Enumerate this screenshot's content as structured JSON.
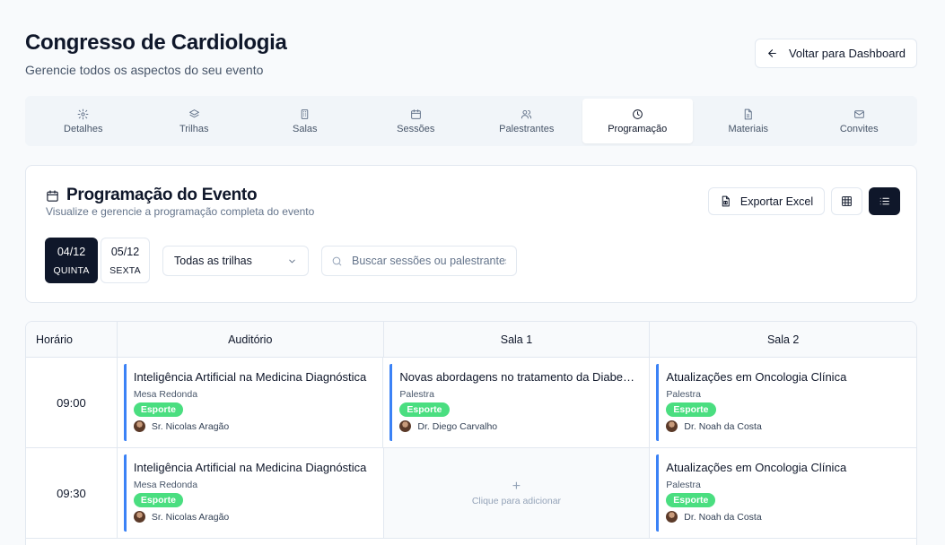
{
  "header": {
    "title": "Congresso de Cardiologia",
    "subtitle": "Gerencie todos os aspectos do seu evento",
    "back_label": "Voltar para Dashboard"
  },
  "tabs": [
    {
      "label": "Detalhes",
      "icon": "gear-icon"
    },
    {
      "label": "Trilhas",
      "icon": "layers-icon"
    },
    {
      "label": "Salas",
      "icon": "building-icon"
    },
    {
      "label": "Sessões",
      "icon": "calendar-icon"
    },
    {
      "label": "Palestrantes",
      "icon": "users-icon"
    },
    {
      "label": "Programação",
      "icon": "clock-icon",
      "active": true
    },
    {
      "label": "Materiais",
      "icon": "file-icon"
    },
    {
      "label": "Convites",
      "icon": "mail-icon"
    }
  ],
  "program": {
    "title": "Programação do Evento",
    "description": "Visualize e gerencie a programação completa do evento",
    "export_label": "Exportar Excel",
    "days": [
      {
        "date": "04/12",
        "weekday": "QUINTA",
        "selected": true
      },
      {
        "date": "05/12",
        "weekday": "SEXTA",
        "selected": false
      }
    ],
    "track_filter": {
      "selected": "Todas as trilhas"
    },
    "search": {
      "placeholder": "Buscar sessões ou palestrantes",
      "value": ""
    }
  },
  "grid": {
    "time_header": "Horário",
    "rooms": [
      "Auditório",
      "Sala 1",
      "Sala 2"
    ],
    "empty_hint": "Clique para adicionar",
    "rows": [
      {
        "time": "09:00",
        "cells": [
          {
            "title": "Inteligência Artificial na Medicina Diagnóstica",
            "type": "Mesa Redonda",
            "track": "Esporte",
            "speaker": "Sr. Nicolas Aragão"
          },
          {
            "title": "Novas abordagens no tratamento da Diabete...",
            "type": "Palestra",
            "track": "Esporte",
            "speaker": "Dr. Diego Carvalho"
          },
          {
            "title": "Atualizações em Oncologia Clínica",
            "type": "Palestra",
            "track": "Esporte",
            "speaker": "Dr. Noah da Costa"
          }
        ]
      },
      {
        "time": "09:30",
        "cells": [
          {
            "title": "Inteligência Artificial na Medicina Diagnóstica",
            "type": "Mesa Redonda",
            "track": "Esporte",
            "speaker": "Sr. Nicolas Aragão"
          },
          null,
          {
            "title": "Atualizações em Oncologia Clínica",
            "type": "Palestra",
            "track": "Esporte",
            "speaker": "Dr. Noah da Costa"
          }
        ]
      }
    ]
  },
  "colors": {
    "primary": "#0f172a",
    "session_border": "#3b82f6",
    "track_badge": "#4ade80"
  }
}
